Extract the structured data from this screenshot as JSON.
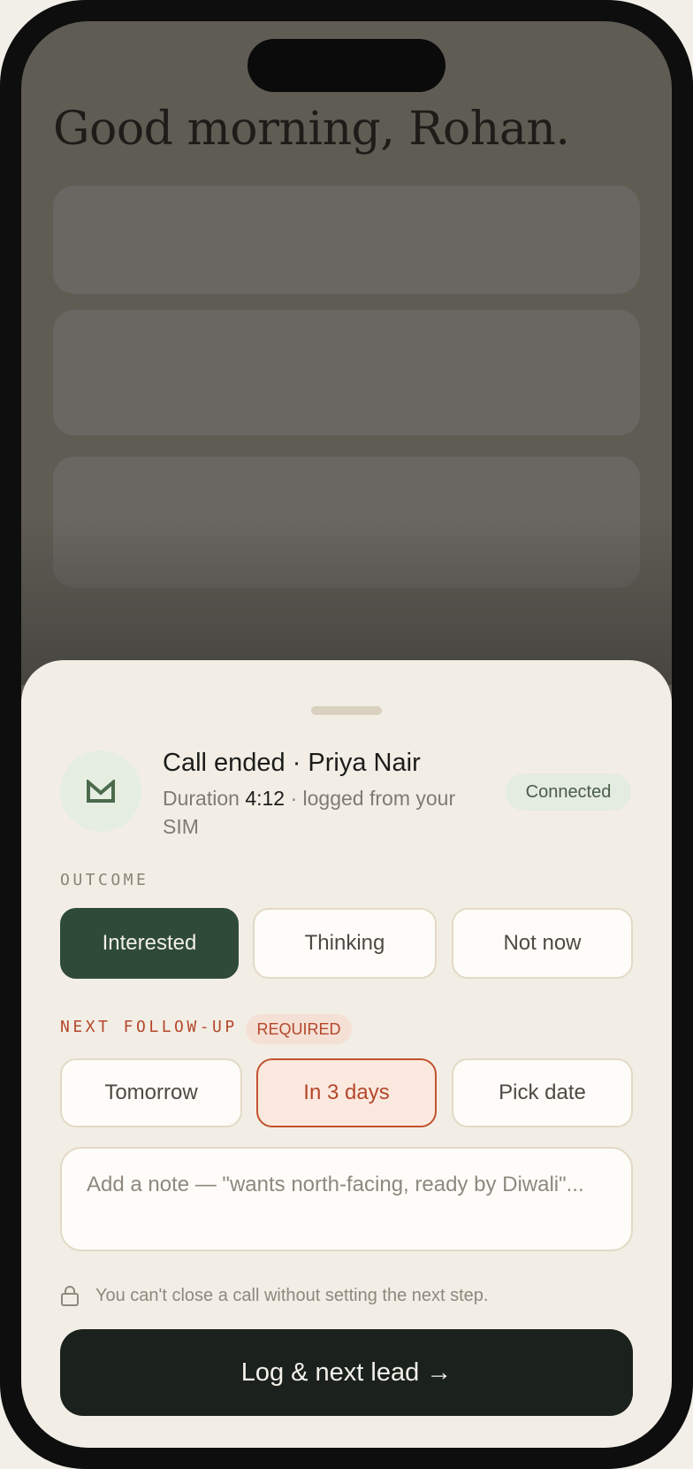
{
  "background": {
    "greeting": "Good morning, Rohan."
  },
  "sheet": {
    "call_title": "Call ended · Priya Nair",
    "duration_label": "Duration",
    "duration_value": "4:12",
    "logged_source": "· logged from your SIM",
    "status_badge": "Connected",
    "avatar_icon": "envelope-icon",
    "outcome": {
      "label": "OUTCOME",
      "options": [
        "Interested",
        "Thinking",
        "Not now"
      ],
      "selected": "Interested"
    },
    "follow_up": {
      "label": "NEXT FOLLOW-UP",
      "required_badge": "REQUIRED",
      "options": [
        "Tomorrow",
        "In 3 days",
        "Pick date"
      ],
      "selected": "In 3 days"
    },
    "note": {
      "placeholder": "Add a note — \"wants north-facing, ready by Diwali\"..."
    },
    "lock_hint": "You can't close a call without setting the next step.",
    "primary_button": "Log & next lead →"
  },
  "colors": {
    "accent_green": "#2f4a38",
    "accent_warm": "#b4472a",
    "sheet_bg": "#f2eee6",
    "cta_bg": "#1b211c"
  }
}
